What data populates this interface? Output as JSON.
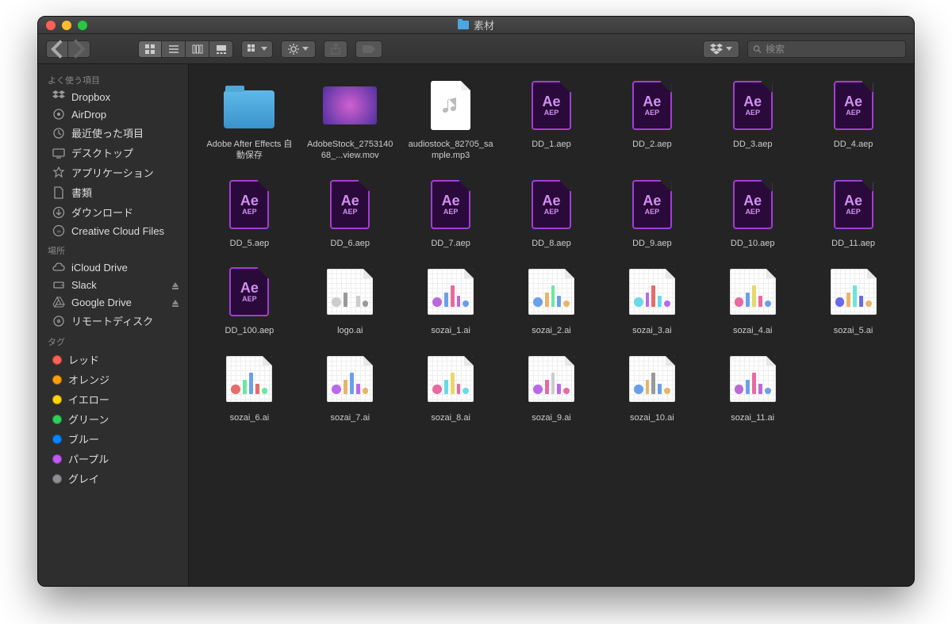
{
  "window": {
    "title": "素材"
  },
  "toolbar": {
    "search_placeholder": "検索"
  },
  "sidebar": {
    "favorites": {
      "header": "よく使う項目",
      "items": [
        {
          "icon": "dropbox",
          "label": "Dropbox"
        },
        {
          "icon": "airdrop",
          "label": "AirDrop"
        },
        {
          "icon": "recent",
          "label": "最近使った項目"
        },
        {
          "icon": "desktop",
          "label": "デスクトップ"
        },
        {
          "icon": "apps",
          "label": "アプリケーション"
        },
        {
          "icon": "docs",
          "label": "書類"
        },
        {
          "icon": "downloads",
          "label": "ダウンロード"
        },
        {
          "icon": "cc",
          "label": "Creative Cloud Files"
        }
      ]
    },
    "locations": {
      "header": "場所",
      "items": [
        {
          "icon": "icloud",
          "label": "iCloud Drive",
          "eject": false
        },
        {
          "icon": "disk",
          "label": "Slack",
          "eject": true
        },
        {
          "icon": "gdrive",
          "label": "Google Drive",
          "eject": true
        },
        {
          "icon": "disc",
          "label": "リモートディスク",
          "eject": false
        }
      ]
    },
    "tags": {
      "header": "タグ",
      "items": [
        {
          "color": "#ff6159",
          "label": "レッド"
        },
        {
          "color": "#ff9f0a",
          "label": "オレンジ"
        },
        {
          "color": "#ffd60a",
          "label": "イエロー"
        },
        {
          "color": "#30d158",
          "label": "グリーン"
        },
        {
          "color": "#0a84ff",
          "label": "ブルー"
        },
        {
          "color": "#bf5af2",
          "label": "パープル"
        },
        {
          "color": "#8e8e93",
          "label": "グレイ"
        }
      ]
    }
  },
  "files": [
    {
      "type": "folder",
      "name": "Adobe After Effects 自動保存"
    },
    {
      "type": "mov",
      "name": "AdobeStock_275314068_...view.mov"
    },
    {
      "type": "mp3",
      "name": "audiostock_82705_sample.mp3"
    },
    {
      "type": "aep",
      "name": "DD_1.aep"
    },
    {
      "type": "aep",
      "name": "DD_2.aep"
    },
    {
      "type": "aep",
      "name": "DD_3.aep"
    },
    {
      "type": "aep",
      "name": "DD_4.aep"
    },
    {
      "type": "aep",
      "name": "DD_5.aep"
    },
    {
      "type": "aep",
      "name": "DD_6.aep"
    },
    {
      "type": "aep",
      "name": "DD_7.aep"
    },
    {
      "type": "aep",
      "name": "DD_8.aep"
    },
    {
      "type": "aep",
      "name": "DD_9.aep"
    },
    {
      "type": "aep",
      "name": "DD_10.aep"
    },
    {
      "type": "aep",
      "name": "DD_11.aep"
    },
    {
      "type": "aep",
      "name": "DD_100.aep"
    },
    {
      "type": "ai",
      "name": "logo.ai",
      "palette": [
        "#ccc",
        "#999"
      ]
    },
    {
      "type": "ai",
      "name": "sozai_1.ai",
      "palette": [
        "#b96ad9",
        "#6aa0e8",
        "#e86aa0"
      ]
    },
    {
      "type": "ai",
      "name": "sozai_2.ai",
      "palette": [
        "#6aa0e8",
        "#e8b46a",
        "#6ae8a0"
      ]
    },
    {
      "type": "ai",
      "name": "sozai_3.ai",
      "palette": [
        "#6ad9e8",
        "#b96ae8",
        "#e86a6a"
      ]
    },
    {
      "type": "ai",
      "name": "sozai_4.ai",
      "palette": [
        "#e86aa0",
        "#6aa0e8",
        "#e8d76a"
      ]
    },
    {
      "type": "ai",
      "name": "sozai_5.ai",
      "palette": [
        "#6a6ae8",
        "#e8b46a",
        "#6ae8d7"
      ]
    },
    {
      "type": "ai",
      "name": "sozai_6.ai",
      "palette": [
        "#e86a6a",
        "#6ae8a0",
        "#6aa0e8"
      ]
    },
    {
      "type": "ai",
      "name": "sozai_7.ai",
      "palette": [
        "#b96ae8",
        "#e8b46a",
        "#6aa0e8"
      ]
    },
    {
      "type": "ai",
      "name": "sozai_8.ai",
      "palette": [
        "#e86aa0",
        "#6ad9e8",
        "#e8d76a"
      ]
    },
    {
      "type": "ai",
      "name": "sozai_9.ai",
      "palette": [
        "#b96ae8",
        "#e86aa0",
        "#cccccc"
      ]
    },
    {
      "type": "ai",
      "name": "sozai_10.ai",
      "palette": [
        "#6aa0e8",
        "#e8b46a",
        "#999999"
      ]
    },
    {
      "type": "ai",
      "name": "sozai_11.ai",
      "palette": [
        "#b96ad9",
        "#6aa0e8",
        "#e86aa0"
      ]
    }
  ]
}
